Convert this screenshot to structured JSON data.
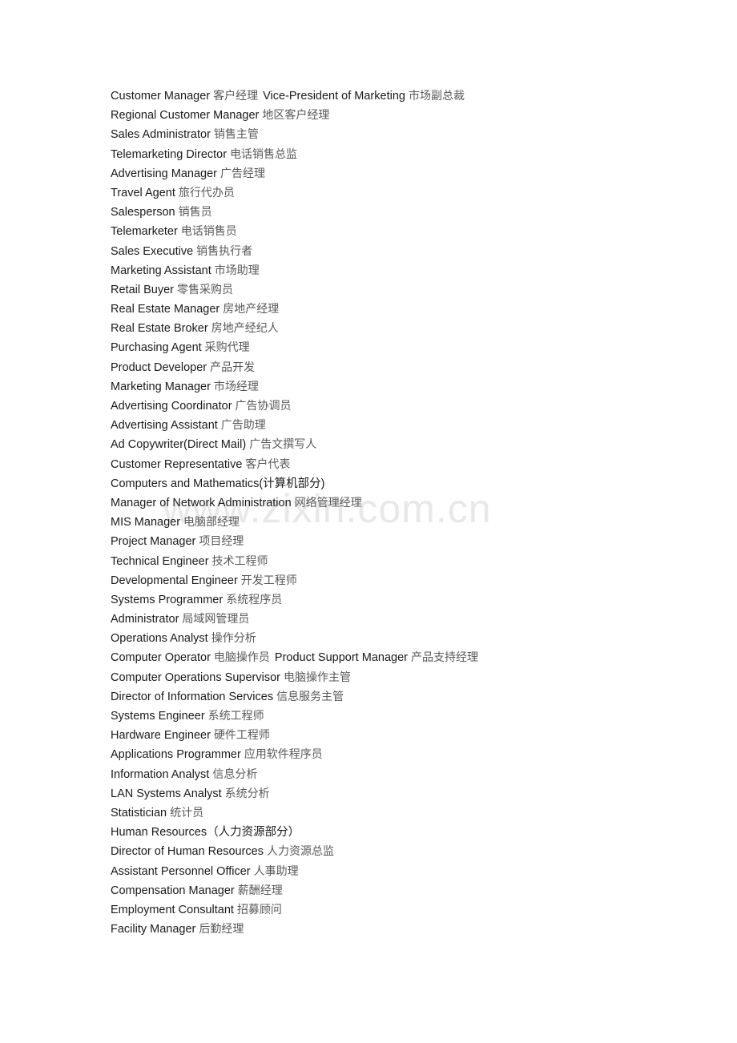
{
  "document": {
    "background_color": "#ffffff",
    "text_color": "#1a1a1a",
    "cn_text_color": "#585858"
  },
  "watermark": {
    "text": "www.zixin.com.cn",
    "color": "#e8e8e8"
  },
  "lines": [
    {
      "en": "Customer Manager",
      "cn": "客户经理",
      "en2": "Vice-President of Marketing",
      "cn2": "市场副总裁"
    },
    {
      "en": "Regional Customer Manager",
      "cn": "地区客户经理"
    },
    {
      "en": "Sales Administrator",
      "cn": "销售主管"
    },
    {
      "en": "Telemarketing Director",
      "cn": "电话销售总监"
    },
    {
      "en": "Advertising Manager",
      "cn": "广告经理"
    },
    {
      "en": "Travel Agent",
      "cn": "旅行代办员"
    },
    {
      "en": "Salesperson",
      "cn": "销售员"
    },
    {
      "en": "Telemarketer",
      "cn": "电话销售员"
    },
    {
      "en": "Sales Executive",
      "cn": "销售执行者"
    },
    {
      "en": "Marketing Assistant",
      "cn": "市场助理"
    },
    {
      "en": "Retail Buyer",
      "cn": "零售采购员"
    },
    {
      "en": "Real Estate Manager",
      "cn": "房地产经理"
    },
    {
      "en": "Real Estate Broker",
      "cn": "房地产经纪人"
    },
    {
      "en": "Purchasing Agent",
      "cn": "采购代理"
    },
    {
      "en": "Product Developer",
      "cn": "产品开发"
    },
    {
      "en": "Marketing Manager",
      "cn": "市场经理"
    },
    {
      "en": "Advertising Coordinator",
      "cn": "广告协调员"
    },
    {
      "en": "Advertising Assistant",
      "cn": "广告助理"
    },
    {
      "en": "Ad Copywriter(Direct Mail)",
      "cn": "广告文撰写人"
    },
    {
      "en": "Customer Representative",
      "cn": "客户代表"
    },
    {
      "en": "Computers and Mathematics(计算机部分)",
      "cn": ""
    },
    {
      "en": "Manager of Network Administration",
      "cn": "网络管理经理"
    },
    {
      "en": "MIS Manager",
      "cn": "电脑部经理"
    },
    {
      "en": "Project Manager",
      "cn": "项目经理"
    },
    {
      "en": "Technical Engineer",
      "cn": "技术工程师"
    },
    {
      "en": "Developmental Engineer",
      "cn": "开发工程师"
    },
    {
      "en": "Systems Programmer",
      "cn": "系统程序员"
    },
    {
      "en": "Administrator",
      "cn": "局域网管理员"
    },
    {
      "en": "Operations Analyst",
      "cn": "操作分析"
    },
    {
      "en": "Computer Operator",
      "cn": "电脑操作员",
      "en2": "Product Support Manager",
      "cn2": "产品支持经理"
    },
    {
      "en": "Computer Operations Supervisor",
      "cn": "电脑操作主管"
    },
    {
      "en": "Director of Information Services",
      "cn": "信息服务主管"
    },
    {
      "en": "Systems Engineer",
      "cn": "系统工程师"
    },
    {
      "en": "Hardware Engineer",
      "cn": "硬件工程师"
    },
    {
      "en": "Applications Programmer",
      "cn": "应用软件程序员"
    },
    {
      "en": "Information Analyst",
      "cn": "信息分析"
    },
    {
      "en": "LAN Systems Analyst",
      "cn": "系统分析"
    },
    {
      "en": "Statistician",
      "cn": "统计员"
    },
    {
      "en": "Human Resources（人力资源部分）",
      "cn": ""
    },
    {
      "en": "Director of Human Resources",
      "cn": "人力资源总监"
    },
    {
      "en": "Assistant Personnel Officer",
      "cn": "人事助理"
    },
    {
      "en": "Compensation Manager",
      "cn": "薪酬经理"
    },
    {
      "en": "Employment Consultant",
      "cn": "招募顾问"
    },
    {
      "en": "Facility Manager",
      "cn": "后勤经理"
    }
  ]
}
